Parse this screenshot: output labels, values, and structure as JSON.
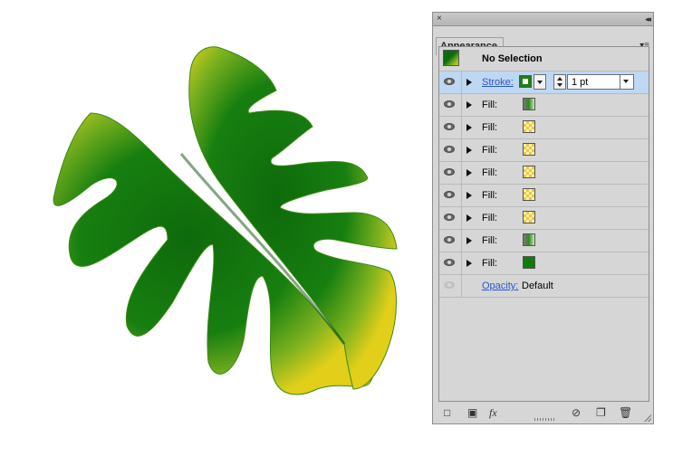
{
  "panel": {
    "tab_label": "Appearance",
    "header_title": "No Selection",
    "close_glyph": "×",
    "collapse_glyph": "◂◂",
    "menu_glyph": "▾≡",
    "rows": [
      {
        "label": "Stroke:",
        "kind": "stroke",
        "selected": true
      },
      {
        "label": "Fill:",
        "kind": "fill",
        "swatch": "gradient"
      },
      {
        "label": "Fill:",
        "kind": "fill",
        "swatch": "pattern"
      },
      {
        "label": "Fill:",
        "kind": "fill",
        "swatch": "pattern"
      },
      {
        "label": "Fill:",
        "kind": "fill",
        "swatch": "pattern"
      },
      {
        "label": "Fill:",
        "kind": "fill",
        "swatch": "pattern"
      },
      {
        "label": "Fill:",
        "kind": "fill",
        "swatch": "pattern"
      },
      {
        "label": "Fill:",
        "kind": "fill",
        "swatch": "gradient"
      },
      {
        "label": "Fill:",
        "kind": "fill",
        "swatch": "solid"
      }
    ],
    "stroke_weight": "1 pt",
    "opacity_label": "Opacity:",
    "opacity_value": "Default",
    "bottom_icons": [
      "new-stroke-icon",
      "new-fill-icon",
      "fx-icon",
      "clear-appearance-icon",
      "duplicate-item-icon",
      "trash-icon"
    ],
    "fx_label": "fx"
  },
  "colors": {
    "panel_bg": "#d6d6d6",
    "selected_row": "#bed7f3",
    "link": "#2b56c7",
    "leaf_dark": "#0f6a0d",
    "leaf_mid": "#1a8410",
    "leaf_yellow": "#e3d21a"
  }
}
